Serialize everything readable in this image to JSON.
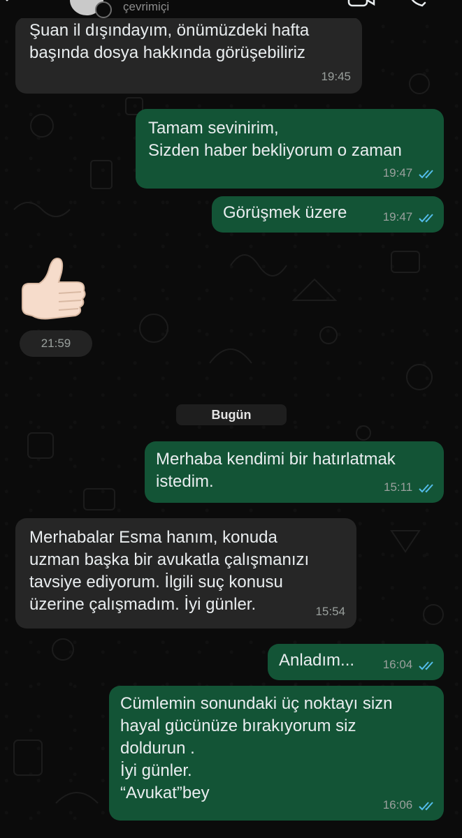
{
  "header": {
    "status": "çevrimiçi"
  },
  "date_divider": "Bugün",
  "messages": [
    {
      "text": "Şuan il dışındayım, önümüzdeki hafta\nbaşında dosya hakkında görüşebiliriz",
      "time": "19:45",
      "direction": "in"
    },
    {
      "text": "Tamam sevinirim,\nSizden haber bekliyorum o zaman",
      "time": "19:47",
      "direction": "out",
      "read": true
    },
    {
      "text": "Görüşmek üzere",
      "time": "19:47",
      "direction": "out",
      "read": true
    },
    {
      "emoji": "thumbs-up",
      "time": "21:59",
      "direction": "in"
    },
    {
      "text": "Merhaba kendimi bir hatırlatmak\nistedim.",
      "time": "15:11",
      "direction": "out",
      "read": true
    },
    {
      "text": "Merhabalar Esma hanım, konuda\nuzman başka bir avukatla çalışmanızı\ntavsiye ediyorum. İlgili suç konusu\nüzerine çalışmadım. İyi günler.",
      "time": "15:54",
      "direction": "in"
    },
    {
      "text": "Anladım...",
      "time": "16:04",
      "direction": "out",
      "read": true
    },
    {
      "text": "Cümlemin sonundaki üç noktayı sizn\nhayal gücünüze bırakıyorum siz\ndoldurun .\nİyi günler.\n“Avukat”bey",
      "time": "16:06",
      "direction": "out",
      "read": true
    }
  ],
  "colors": {
    "incoming_bubble": "#262626",
    "outgoing_bubble": "#135436",
    "read_ticks": "#53bdeb",
    "background": "#0b0b0b"
  }
}
